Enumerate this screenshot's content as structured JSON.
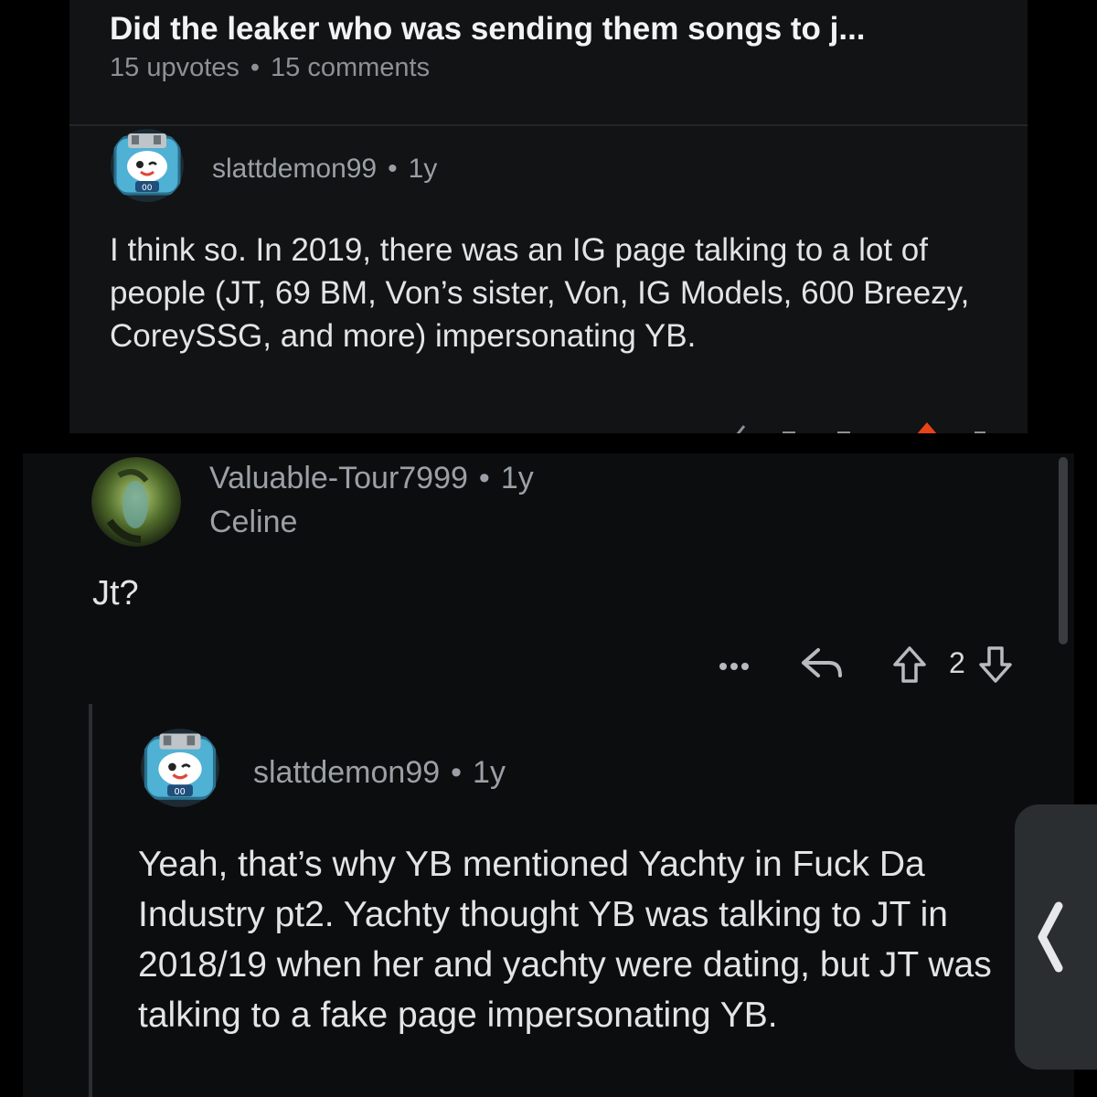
{
  "post": {
    "title": "Did the leaker who was sending them songs to j...",
    "upvotes": "15 upvotes",
    "comments": "15 comments",
    "meta_separator": "•"
  },
  "comment1": {
    "username": "slattdemon99",
    "age": "1y",
    "separator": "•",
    "text": "I think so. In 2019, there was an IG page talking to a lot of people (JT, 69 BM, Von’s sister, Von, IG Models, 600 Breezy, CoreySSG, and more) impersonating YB.",
    "avatar_icon": "snoo-avatar-icon"
  },
  "comment2": {
    "username": "Valuable-Tour7999",
    "age": "1y",
    "separator": "•",
    "flair": "Celine",
    "text": "Jt?",
    "avatar_icon": "green-photo-avatar-icon",
    "actions": {
      "more_icon": "more-dots-icon",
      "reply_icon": "reply-arrow-icon",
      "upvote_icon": "upvote-arrow-icon",
      "score": "2",
      "downvote_icon": "downvote-arrow-icon"
    }
  },
  "comment3": {
    "username": "slattdemon99",
    "age": "1y",
    "separator": "•",
    "text": "Yeah, that’s why YB mentioned Yachty in Fuck Da Industry pt2. Yachty thought YB was talking to JT in 2018/19 when her and yachty were dating, but JT was talking to a fake page impersonating YB.",
    "avatar_icon": "snoo-avatar-icon"
  },
  "side_handle": {
    "icon": "chevron-left-icon"
  },
  "colors": {
    "background": "#000000",
    "card_top": "#111314",
    "card_bottom": "#0c0d0e",
    "upvote_accent": "#e8441a",
    "text_primary": "#e2e4e6",
    "text_muted": "#8c9196"
  }
}
